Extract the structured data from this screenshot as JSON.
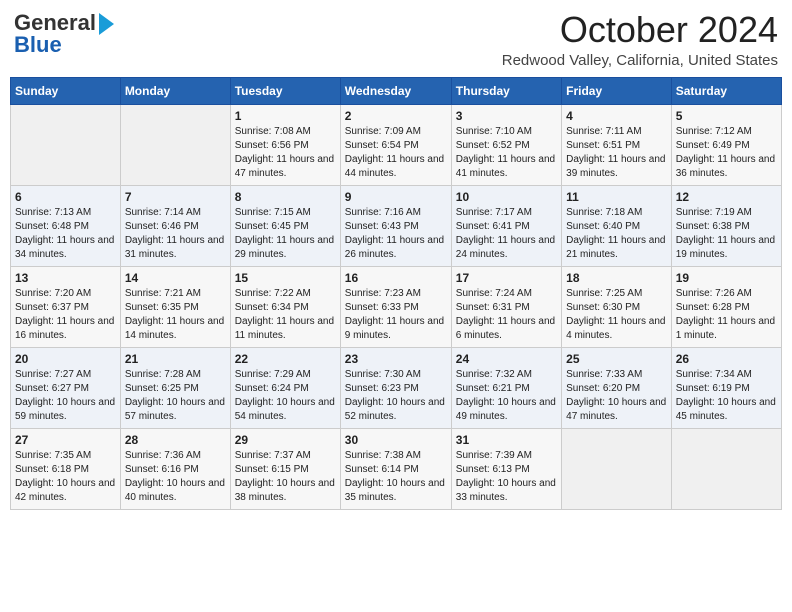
{
  "header": {
    "logo_general": "General",
    "logo_blue": "Blue",
    "month_title": "October 2024",
    "location": "Redwood Valley, California, United States"
  },
  "days_of_week": [
    "Sunday",
    "Monday",
    "Tuesday",
    "Wednesday",
    "Thursday",
    "Friday",
    "Saturday"
  ],
  "weeks": [
    [
      {
        "day": "",
        "sunrise": "",
        "sunset": "",
        "daylight": ""
      },
      {
        "day": "",
        "sunrise": "",
        "sunset": "",
        "daylight": ""
      },
      {
        "day": "1",
        "sunrise": "Sunrise: 7:08 AM",
        "sunset": "Sunset: 6:56 PM",
        "daylight": "Daylight: 11 hours and 47 minutes."
      },
      {
        "day": "2",
        "sunrise": "Sunrise: 7:09 AM",
        "sunset": "Sunset: 6:54 PM",
        "daylight": "Daylight: 11 hours and 44 minutes."
      },
      {
        "day": "3",
        "sunrise": "Sunrise: 7:10 AM",
        "sunset": "Sunset: 6:52 PM",
        "daylight": "Daylight: 11 hours and 41 minutes."
      },
      {
        "day": "4",
        "sunrise": "Sunrise: 7:11 AM",
        "sunset": "Sunset: 6:51 PM",
        "daylight": "Daylight: 11 hours and 39 minutes."
      },
      {
        "day": "5",
        "sunrise": "Sunrise: 7:12 AM",
        "sunset": "Sunset: 6:49 PM",
        "daylight": "Daylight: 11 hours and 36 minutes."
      }
    ],
    [
      {
        "day": "6",
        "sunrise": "Sunrise: 7:13 AM",
        "sunset": "Sunset: 6:48 PM",
        "daylight": "Daylight: 11 hours and 34 minutes."
      },
      {
        "day": "7",
        "sunrise": "Sunrise: 7:14 AM",
        "sunset": "Sunset: 6:46 PM",
        "daylight": "Daylight: 11 hours and 31 minutes."
      },
      {
        "day": "8",
        "sunrise": "Sunrise: 7:15 AM",
        "sunset": "Sunset: 6:45 PM",
        "daylight": "Daylight: 11 hours and 29 minutes."
      },
      {
        "day": "9",
        "sunrise": "Sunrise: 7:16 AM",
        "sunset": "Sunset: 6:43 PM",
        "daylight": "Daylight: 11 hours and 26 minutes."
      },
      {
        "day": "10",
        "sunrise": "Sunrise: 7:17 AM",
        "sunset": "Sunset: 6:41 PM",
        "daylight": "Daylight: 11 hours and 24 minutes."
      },
      {
        "day": "11",
        "sunrise": "Sunrise: 7:18 AM",
        "sunset": "Sunset: 6:40 PM",
        "daylight": "Daylight: 11 hours and 21 minutes."
      },
      {
        "day": "12",
        "sunrise": "Sunrise: 7:19 AM",
        "sunset": "Sunset: 6:38 PM",
        "daylight": "Daylight: 11 hours and 19 minutes."
      }
    ],
    [
      {
        "day": "13",
        "sunrise": "Sunrise: 7:20 AM",
        "sunset": "Sunset: 6:37 PM",
        "daylight": "Daylight: 11 hours and 16 minutes."
      },
      {
        "day": "14",
        "sunrise": "Sunrise: 7:21 AM",
        "sunset": "Sunset: 6:35 PM",
        "daylight": "Daylight: 11 hours and 14 minutes."
      },
      {
        "day": "15",
        "sunrise": "Sunrise: 7:22 AM",
        "sunset": "Sunset: 6:34 PM",
        "daylight": "Daylight: 11 hours and 11 minutes."
      },
      {
        "day": "16",
        "sunrise": "Sunrise: 7:23 AM",
        "sunset": "Sunset: 6:33 PM",
        "daylight": "Daylight: 11 hours and 9 minutes."
      },
      {
        "day": "17",
        "sunrise": "Sunrise: 7:24 AM",
        "sunset": "Sunset: 6:31 PM",
        "daylight": "Daylight: 11 hours and 6 minutes."
      },
      {
        "day": "18",
        "sunrise": "Sunrise: 7:25 AM",
        "sunset": "Sunset: 6:30 PM",
        "daylight": "Daylight: 11 hours and 4 minutes."
      },
      {
        "day": "19",
        "sunrise": "Sunrise: 7:26 AM",
        "sunset": "Sunset: 6:28 PM",
        "daylight": "Daylight: 11 hours and 1 minute."
      }
    ],
    [
      {
        "day": "20",
        "sunrise": "Sunrise: 7:27 AM",
        "sunset": "Sunset: 6:27 PM",
        "daylight": "Daylight: 10 hours and 59 minutes."
      },
      {
        "day": "21",
        "sunrise": "Sunrise: 7:28 AM",
        "sunset": "Sunset: 6:25 PM",
        "daylight": "Daylight: 10 hours and 57 minutes."
      },
      {
        "day": "22",
        "sunrise": "Sunrise: 7:29 AM",
        "sunset": "Sunset: 6:24 PM",
        "daylight": "Daylight: 10 hours and 54 minutes."
      },
      {
        "day": "23",
        "sunrise": "Sunrise: 7:30 AM",
        "sunset": "Sunset: 6:23 PM",
        "daylight": "Daylight: 10 hours and 52 minutes."
      },
      {
        "day": "24",
        "sunrise": "Sunrise: 7:32 AM",
        "sunset": "Sunset: 6:21 PM",
        "daylight": "Daylight: 10 hours and 49 minutes."
      },
      {
        "day": "25",
        "sunrise": "Sunrise: 7:33 AM",
        "sunset": "Sunset: 6:20 PM",
        "daylight": "Daylight: 10 hours and 47 minutes."
      },
      {
        "day": "26",
        "sunrise": "Sunrise: 7:34 AM",
        "sunset": "Sunset: 6:19 PM",
        "daylight": "Daylight: 10 hours and 45 minutes."
      }
    ],
    [
      {
        "day": "27",
        "sunrise": "Sunrise: 7:35 AM",
        "sunset": "Sunset: 6:18 PM",
        "daylight": "Daylight: 10 hours and 42 minutes."
      },
      {
        "day": "28",
        "sunrise": "Sunrise: 7:36 AM",
        "sunset": "Sunset: 6:16 PM",
        "daylight": "Daylight: 10 hours and 40 minutes."
      },
      {
        "day": "29",
        "sunrise": "Sunrise: 7:37 AM",
        "sunset": "Sunset: 6:15 PM",
        "daylight": "Daylight: 10 hours and 38 minutes."
      },
      {
        "day": "30",
        "sunrise": "Sunrise: 7:38 AM",
        "sunset": "Sunset: 6:14 PM",
        "daylight": "Daylight: 10 hours and 35 minutes."
      },
      {
        "day": "31",
        "sunrise": "Sunrise: 7:39 AM",
        "sunset": "Sunset: 6:13 PM",
        "daylight": "Daylight: 10 hours and 33 minutes."
      },
      {
        "day": "",
        "sunrise": "",
        "sunset": "",
        "daylight": ""
      },
      {
        "day": "",
        "sunrise": "",
        "sunset": "",
        "daylight": ""
      }
    ]
  ]
}
